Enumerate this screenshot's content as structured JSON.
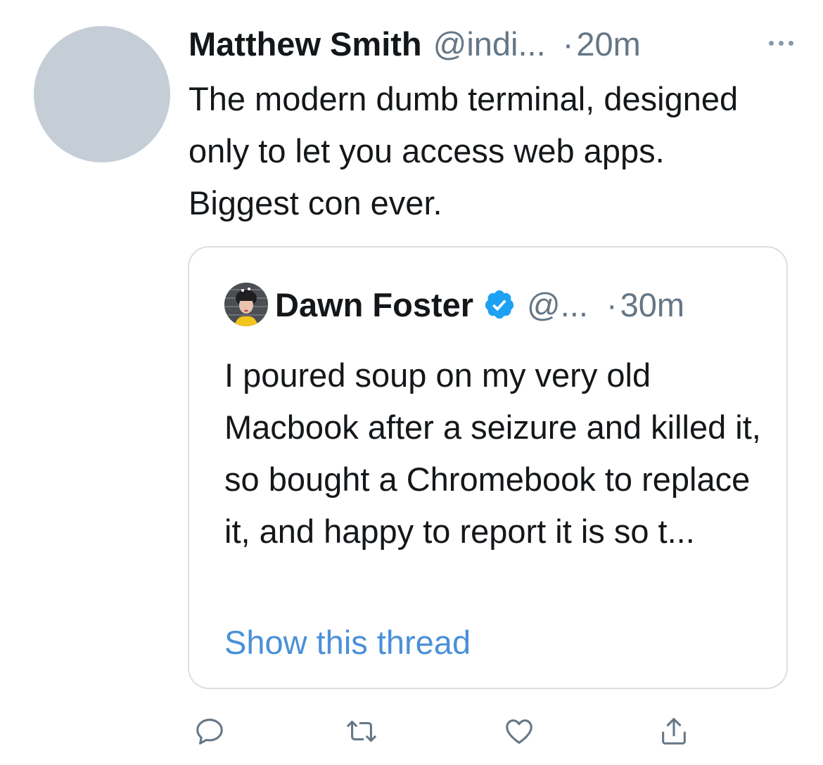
{
  "tweet": {
    "author_name": "Matthew Smith",
    "author_handle": "@indi...",
    "time_separator": "·",
    "time": "20m",
    "more_icon": "more-horizontal-icon",
    "text": "The modern dumb terminal, designed only to let you access web apps. Biggest con ever."
  },
  "quoted_tweet": {
    "author_name": "Dawn Foster",
    "verified_icon": "verified-badge-icon",
    "author_handle": "@...",
    "time_separator": "·",
    "time": "30m",
    "text": "I poured soup on my very old Macbook after a seizure and killed it, so bought a Chromebook to replace it, and happy to report it is so t...",
    "show_thread_label": "Show this thread"
  },
  "actions": [
    {
      "icon": "reply-icon"
    },
    {
      "icon": "retweet-icon"
    },
    {
      "icon": "like-icon"
    },
    {
      "icon": "share-icon"
    }
  ],
  "colors": {
    "text": "#14171a",
    "secondary": "#657786",
    "link": "#4a90d9",
    "verified": "#1da1f2",
    "avatar_placeholder": "#c5ced7",
    "border": "#d9dfe4"
  }
}
